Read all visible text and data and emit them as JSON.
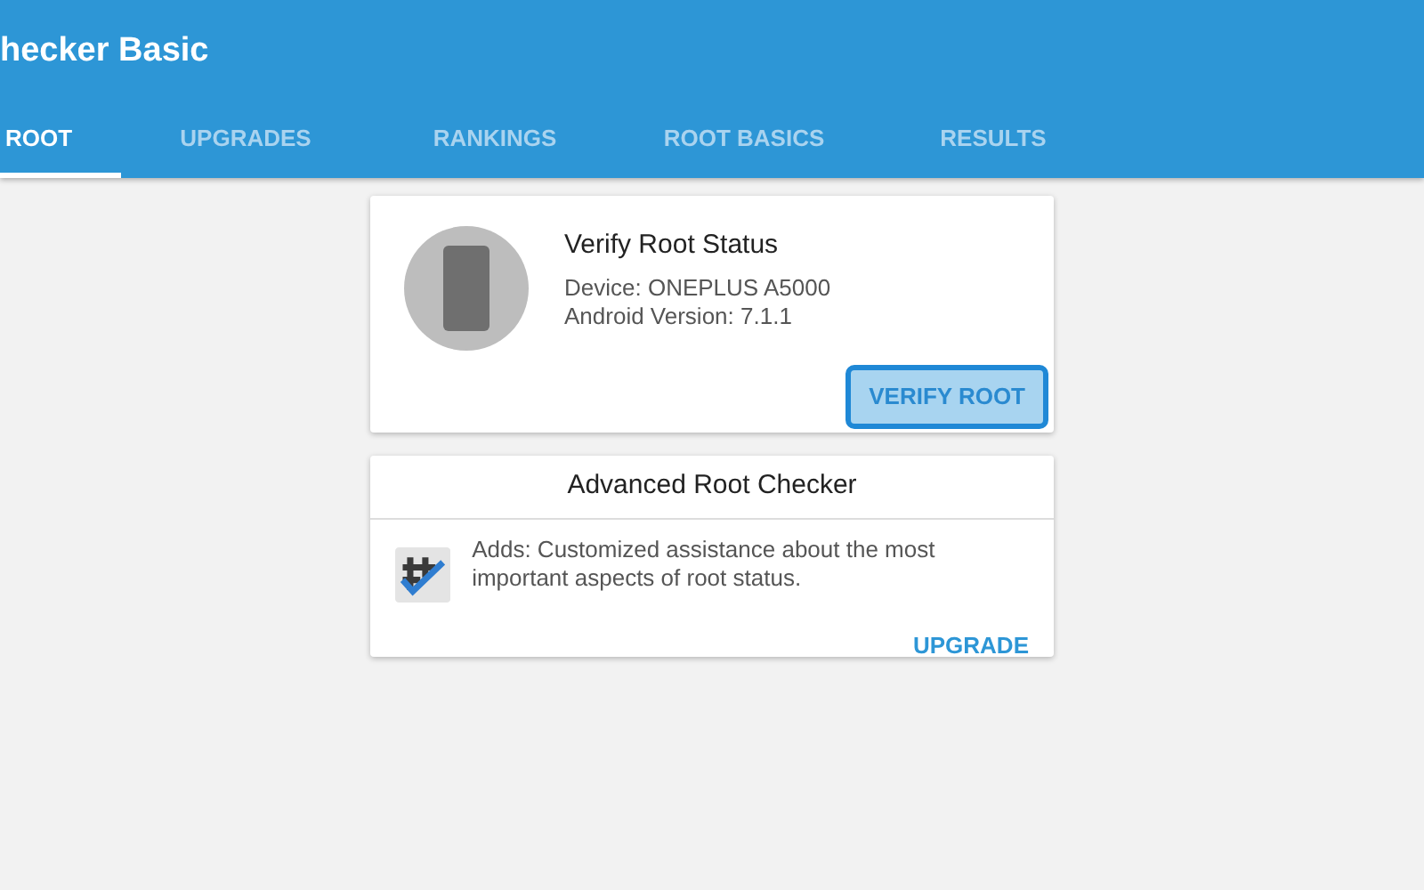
{
  "app_bar": {
    "title": "hecker Basic"
  },
  "tabs": [
    {
      "label": "ROOT",
      "selected": true
    },
    {
      "label": "UPGRADES",
      "selected": false
    },
    {
      "label": "RANKINGS",
      "selected": false
    },
    {
      "label": "ROOT BASICS",
      "selected": false
    },
    {
      "label": "RESULTS",
      "selected": false
    }
  ],
  "verify_card": {
    "title": "Verify Root Status",
    "device": "Device: ONEPLUS A5000",
    "android_version": "Android Version: 7.1.1",
    "button": "VERIFY ROOT"
  },
  "upgrade_card": {
    "title": "Advanced Root Checker",
    "description": "Adds: Customized assistance about the most important aspects of root status.",
    "button": "UPGRADE"
  }
}
